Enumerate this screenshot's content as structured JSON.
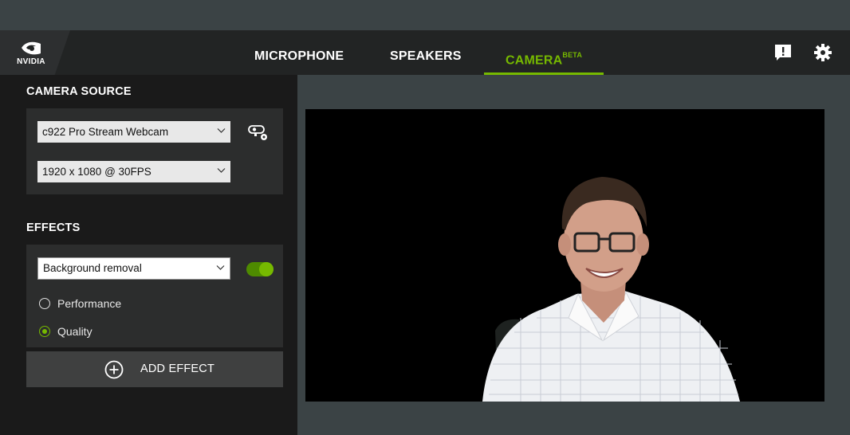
{
  "header": {
    "logo_text": "NVIDIA",
    "tabs": [
      {
        "label": "MICROPHONE",
        "beta": ""
      },
      {
        "label": "SPEAKERS",
        "beta": ""
      },
      {
        "label": "CAMERA",
        "beta": "BETA"
      }
    ],
    "active_tab": "CAMERA",
    "accent_color": "#76b900"
  },
  "camera_source": {
    "title": "CAMERA SOURCE",
    "device": "c922 Pro Stream Webcam",
    "resolution": "1920 x 1080 @ 30FPS"
  },
  "effects": {
    "title": "EFFECTS",
    "selected_effect": "Background removal",
    "enabled": true,
    "options": [
      {
        "label": "Performance",
        "checked": false
      },
      {
        "label": "Quality",
        "checked": true
      }
    ],
    "add_label": "ADD EFFECT"
  },
  "icons": [
    "nvidia-logo",
    "feedback-icon",
    "settings-gear-icon",
    "camera-settings-icon",
    "chevron-down-icon",
    "add-circle-icon"
  ]
}
